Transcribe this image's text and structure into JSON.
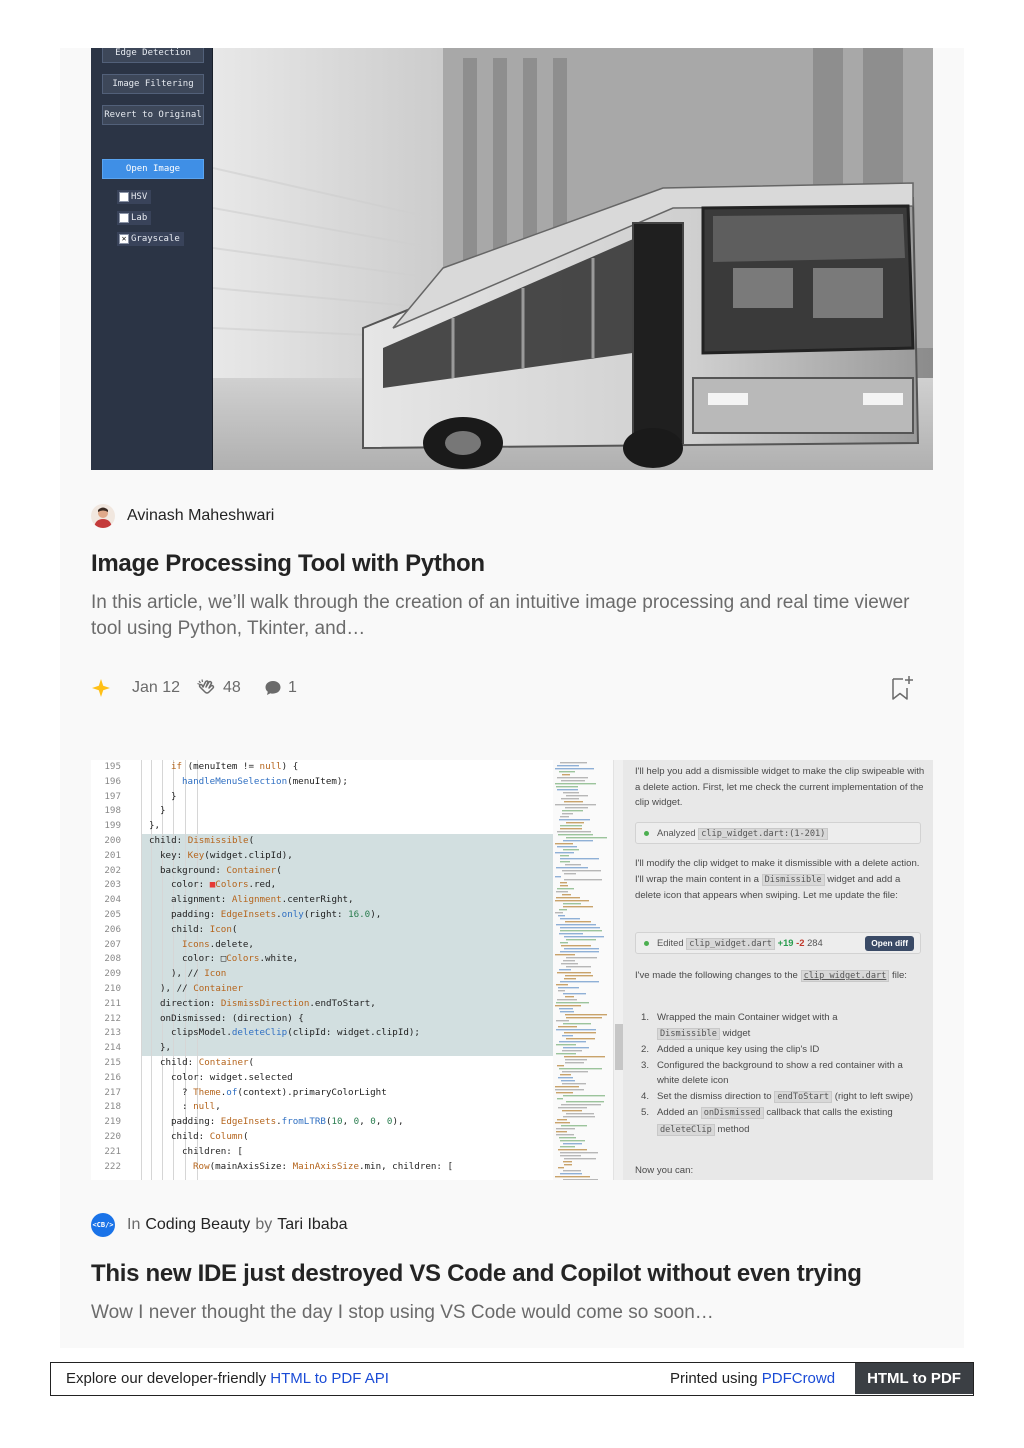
{
  "article1": {
    "author": "Avinash Maheshwari",
    "title": "Image Processing Tool with Python",
    "subtitle": "In this article, we’ll walk through the creation of an intuitive image processing and real time viewer tool using Python, Tkinter, and…",
    "date": "Jan 12",
    "claps": "48",
    "comments": "1",
    "image": {
      "panel_buttons": [
        "Edge Detection",
        "Image Filtering",
        "Revert to Original"
      ],
      "open_button": "Open Image",
      "checkboxes": [
        {
          "label": "HSV",
          "checked": false
        },
        {
          "label": "Lab",
          "checked": false
        },
        {
          "label": "Grayscale",
          "checked": true
        }
      ]
    }
  },
  "article2": {
    "pub_prefix": "In",
    "publication": "Coding Beauty",
    "by": "by",
    "author": "Tari Ibaba",
    "pub_icon_text": "<CB/>",
    "title": "This new IDE just destroyed VS Code and Copilot without even trying",
    "subtitle": "Wow I never thought the day I stop using VS Code would come so soon…",
    "image": {
      "code_lines": [
        {
          "n": "195",
          "text": "if (menuItem != null) {",
          "indent": 8
        },
        {
          "n": "196",
          "text": "handleMenuSelection(menuItem);",
          "indent": 9
        },
        {
          "n": "197",
          "text": "}",
          "indent": 8
        },
        {
          "n": "198",
          "text": "}",
          "indent": 7
        },
        {
          "n": "199",
          "text": "},",
          "indent": 6
        },
        {
          "n": "200",
          "text": "child: Dismissible(",
          "indent": 6
        },
        {
          "n": "201",
          "text": "key: Key(widget.clipId),",
          "indent": 7
        },
        {
          "n": "202",
          "text": "background: Container(",
          "indent": 7
        },
        {
          "n": "203",
          "text": "color: ■Colors.red,",
          "indent": 8
        },
        {
          "n": "204",
          "text": "alignment: Alignment.centerRight,",
          "indent": 8
        },
        {
          "n": "205",
          "text": "padding: EdgeInsets.only(right: 16.0),",
          "indent": 8
        },
        {
          "n": "206",
          "text": "child: Icon(",
          "indent": 8
        },
        {
          "n": "207",
          "text": "Icons.delete,",
          "indent": 9
        },
        {
          "n": "208",
          "text": "color: □Colors.white,",
          "indent": 9
        },
        {
          "n": "209",
          "text": "), // Icon",
          "indent": 8
        },
        {
          "n": "210",
          "text": "), // Container",
          "indent": 7
        },
        {
          "n": "211",
          "text": "direction: DismissDirection.endToStart,",
          "indent": 7
        },
        {
          "n": "212",
          "text": "onDismissed: (direction) {",
          "indent": 7
        },
        {
          "n": "213",
          "text": "clipsModel.deleteClip(clipId: widget.clipId);",
          "indent": 8
        },
        {
          "n": "214",
          "text": "},",
          "indent": 7
        },
        {
          "n": "215",
          "text": "child: Container(",
          "indent": 7
        },
        {
          "n": "216",
          "text": "color: widget.selected",
          "indent": 8
        },
        {
          "n": "217",
          "text": "? Theme.of(context).primaryColorLight",
          "indent": 9
        },
        {
          "n": "218",
          "text": ": null,",
          "indent": 9
        },
        {
          "n": "219",
          "text": "padding: EdgeInsets.fromLTRB(10, 0, 0, 0),",
          "indent": 8
        },
        {
          "n": "220",
          "text": "child: Column(",
          "indent": 8
        },
        {
          "n": "221",
          "text": "children: [",
          "indent": 9
        },
        {
          "n": "222",
          "text": "Row(mainAxisSize: MainAxisSize.min, children: [",
          "indent": 10
        }
      ],
      "chat": {
        "intro": "I'll help you add a dismissible widget to make the clip swipeable with a delete action. First, let me check the current implementation of the clip widget.",
        "analyzed_label": "Analyzed",
        "analyzed_file": "clip_widget.dart:(1-201)",
        "modify_1": "I'll modify the clip widget to make it dismissible with a delete action. I'll wrap the main content in a",
        "modify_chip": "Dismissible",
        "modify_2": "widget and add a delete icon that appears when swiping. Let me update the file:",
        "edited_label": "Edited",
        "edited_file": "clip_widget.dart",
        "added": "+19",
        "removed": "-2",
        "edited_count": "284",
        "open_diff": "Open diff",
        "changes_1": "I've made the following changes to the",
        "changes_file": "clip_widget.dart",
        "changes_2": "file:",
        "list": [
          {
            "n": "1.",
            "a": "Wrapped the main Container widget with a",
            "chip": "Dismissible",
            "b": "widget"
          },
          {
            "n": "2.",
            "a": "Added a unique key using the clip's ID",
            "chip": "",
            "b": ""
          },
          {
            "n": "3.",
            "a": "Configured the background to show a red container with a white delete icon",
            "chip": "",
            "b": ""
          },
          {
            "n": "4.",
            "a": "Set the dismiss direction to",
            "chip": "endToStart",
            "b": "(right to left swipe)"
          },
          {
            "n": "5.",
            "a": "Added an",
            "chip": "onDismissed",
            "b": "callback that calls the existing"
          }
        ],
        "list5_chip2": "deleteClip",
        "list5_tail": "method",
        "outro": "Now you can:"
      }
    }
  },
  "footer": {
    "left_text": "Explore our developer-friendly",
    "left_link": "HTML to PDF API",
    "right_text": "Printed using",
    "right_link": "PDFCrowd",
    "cta": "HTML to PDF"
  },
  "colors": {
    "background": "#f9f9f9",
    "text_primary": "#242424",
    "text_secondary": "#6b6b6b",
    "star": "#ffc017",
    "link": "#1a4bd6",
    "pub_badge": "#1a73e8"
  },
  "icons": [
    "member-star-icon",
    "clap-icon",
    "comment-icon",
    "bookmark-add-icon"
  ]
}
